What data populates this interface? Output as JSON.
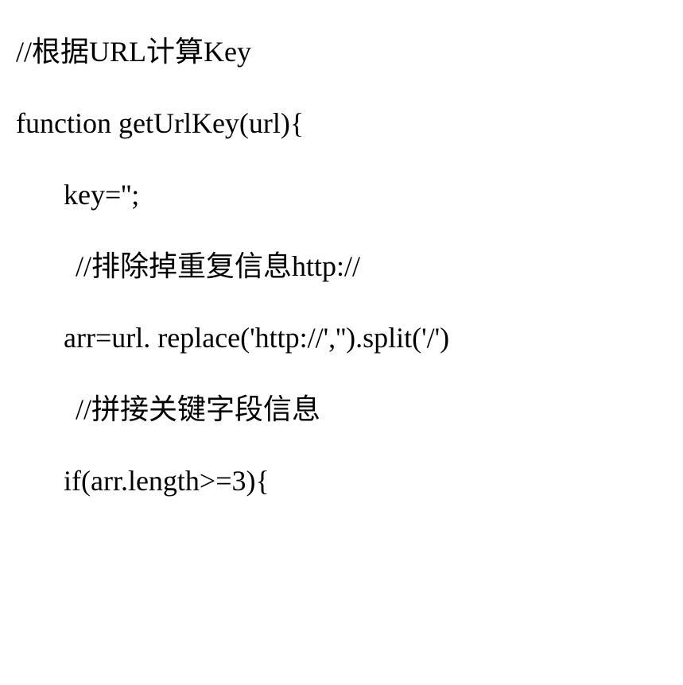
{
  "lines": {
    "l0": "//根据URL计算Key",
    "l1": "function getUrlKey(url){",
    "l2": "key='';",
    "l3": "//排除掉重复信息http://",
    "l4": "arr=url. replace('http://','').split('/')",
    "l5": "//拼接关键字段信息",
    "l6": "if(arr.length>=3){"
  }
}
